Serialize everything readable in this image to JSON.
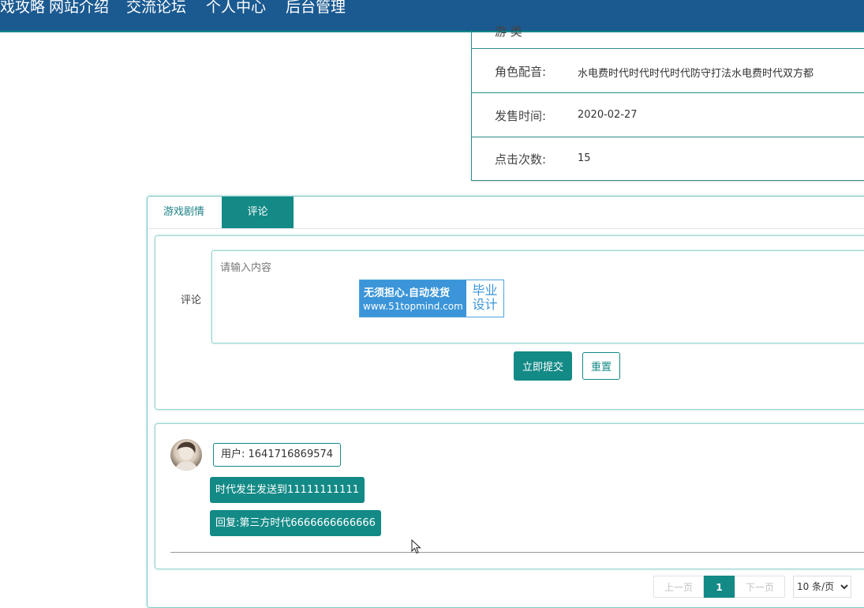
{
  "nav": {
    "items": [
      "戏攻略",
      "网站介绍",
      "交流论坛",
      "个人中心",
      "后台管理"
    ]
  },
  "info": {
    "partial_label": "游    类",
    "rows": [
      {
        "label": "角色配音:",
        "value": "水电费时代时代时代时代防守打法水电费时代双方都"
      },
      {
        "label": "发售时间:",
        "value": "2020-02-27"
      },
      {
        "label": "点击次数:",
        "value": "15"
      }
    ]
  },
  "tabs": [
    {
      "label": "游戏剧情",
      "active": false
    },
    {
      "label": "评论",
      "active": true
    }
  ],
  "comment_form": {
    "label": "评论",
    "placeholder": "请输入内容",
    "submit_label": "立即提交",
    "reset_label": "重置"
  },
  "watermark": {
    "line1": "无须担心.自动发货",
    "line2": "www.51topmind.com",
    "side_top": "毕业",
    "side_bottom": "设计"
  },
  "comments": [
    {
      "user": "用户: 1641716869574",
      "content": "时代发生发送到11111111111",
      "reply": "回复:第三方时代6666666666666"
    }
  ],
  "pagination": {
    "prev": "上一页",
    "current": "1",
    "next": "下一页",
    "page_size": "10 条/页"
  },
  "colors": {
    "nav_bg": "#1b5a91",
    "accent": "#138a86"
  }
}
